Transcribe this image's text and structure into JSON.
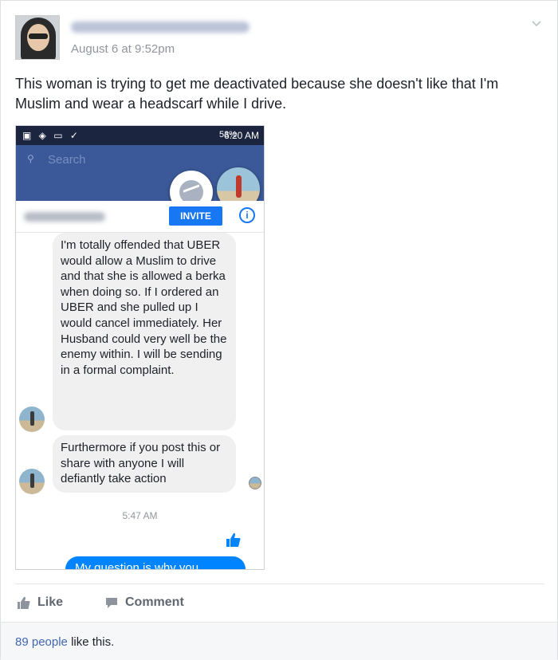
{
  "post": {
    "timestamp": "August 6 at 9:52pm",
    "text": "This woman is trying to get me deactivated because she doesn't like that I'm Muslim and wear a headscarf while I drive."
  },
  "screenshot": {
    "statusbar": {
      "battery": "53%",
      "time": "6:20 AM"
    },
    "search_placeholder": "Search",
    "invite_label": "INVITE",
    "info_glyph": "i",
    "messages": [
      {
        "text": "I'm totally offended that UBER  would allow a Muslim to drive and that she is allowed a berka when doing so. If I ordered an UBER and she pulled up I would cancel immediately.  Her Husband could very well be the enemy within. I will be sending in a formal complaint."
      },
      {
        "text": "Furthermore if you post this or share with anyone I will defiantly take action"
      }
    ],
    "message_time": "5:47 AM",
    "outgoing_partial": "My question is why you"
  },
  "actions": {
    "like_label": "Like",
    "comment_label": "Comment"
  },
  "footer": {
    "likes_count": "89 people",
    "likes_suffix": " like this."
  },
  "colors": {
    "facebook_blue": "#3b5998",
    "link_blue": "#4267b2",
    "messenger_blue": "#0084ff"
  }
}
